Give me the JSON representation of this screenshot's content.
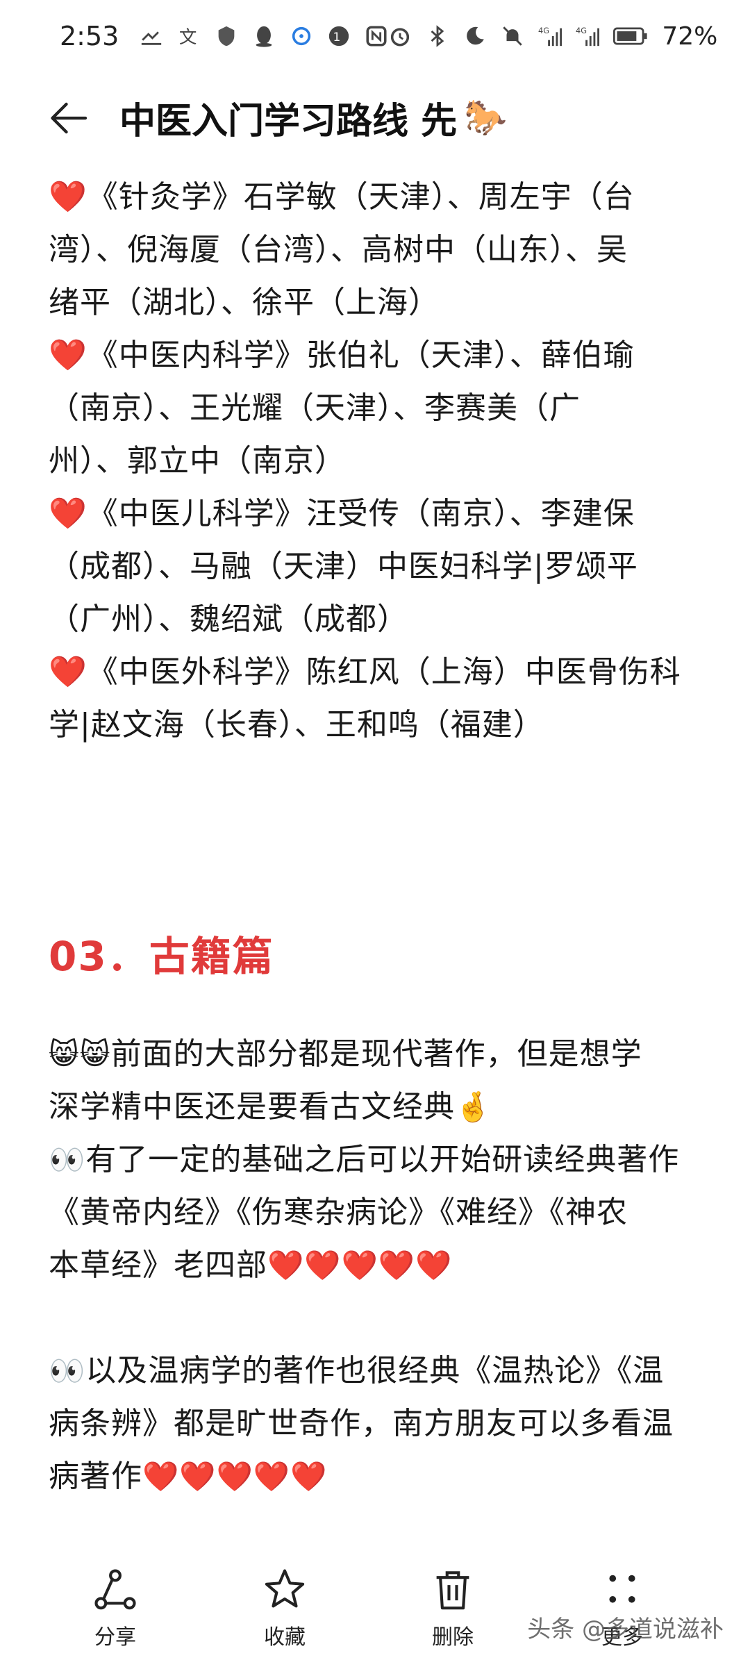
{
  "status_bar": {
    "time": "2:53",
    "battery": "72%",
    "left_icons": [
      "missed-call-icon",
      "translate-icon",
      "shield-icon",
      "qq-icon",
      "chat-icon",
      "sim-icon",
      "nfc-icon"
    ],
    "right_icons": [
      "alarm-icon",
      "bluetooth-icon",
      "moon-icon",
      "mute-icon",
      "signal-4g-1-icon",
      "signal-4g-2-icon",
      "battery-icon"
    ]
  },
  "header": {
    "title": "中医入门学习路线  先",
    "title_emoji": "🐎"
  },
  "doctors": [
    {
      "lines": [
        "《针灸学》石学敏（天津）、周左宇（台",
        "湾）、倪海厦（台湾）、高树中（山东）、吴",
        "绪平（湖北）、徐平（上海）"
      ]
    },
    {
      "lines": [
        "《中医内科学》张伯礼（天津）、薛伯瑜",
        "（南京）、王光耀（天津）、李赛美（广",
        "州）、郭立中（南京）"
      ]
    },
    {
      "lines": [
        "《中医儿科学》汪受传（南京）、李建保",
        "（成都）、马融（天津）中医妇科学|罗颂平",
        "（广州）、魏绍斌（成都）"
      ]
    },
    {
      "lines": [
        "《中医外科学》陈红风（上海）中医骨伤科",
        "学|赵文海（长春）、王和鸣（福建）"
      ]
    }
  ],
  "heart_emoji": "❤️",
  "section_title": "03．古籍篇",
  "classics": {
    "p1": {
      "prefix": "😸😸",
      "lines": [
        "前面的大部分都是现代著作，但是想学",
        "深学精中医还是要看古文经典"
      ],
      "suffix": "🤞"
    },
    "p2": {
      "prefix": "👀",
      "lines": [
        "有了一定的基础之后可以开始研读经典著作",
        "《黄帝内经》《伤寒杂病论》《难经》《神农",
        "本草经》老四部"
      ],
      "suffix": "❤️❤️❤️❤️❤️"
    },
    "p3": {
      "prefix": "👀",
      "lines": [
        "以及温病学的著作也很经典《温热论》《温",
        "病条辨》都是旷世奇作，南方朋友可以多看温",
        "病著作"
      ],
      "suffix": "❤️❤️❤️❤️❤️"
    }
  },
  "bottom_bar": {
    "share": "分享",
    "favorite": "收藏",
    "delete": "删除",
    "more": "更多"
  },
  "watermark": "头条 @多道说滋补"
}
